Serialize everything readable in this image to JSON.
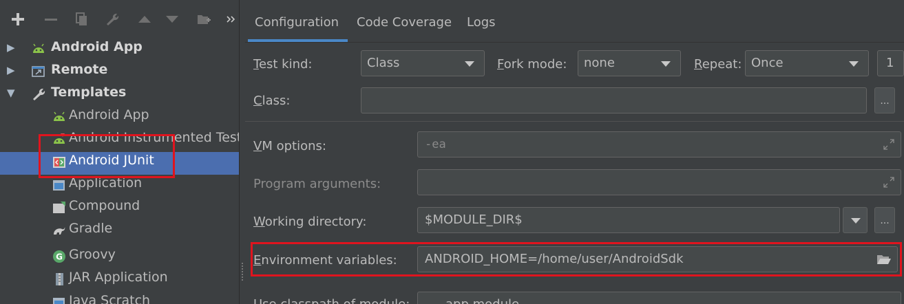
{
  "toolbar": {
    "icons": [
      "add-icon",
      "remove-icon",
      "copy-icon",
      "wrench-icon",
      "move-up-icon",
      "move-down-icon",
      "folder-add-icon",
      "more-icon"
    ]
  },
  "tree": {
    "items": [
      {
        "label": "Android App",
        "icon": "android-icon",
        "bold": true,
        "expanded": false
      },
      {
        "label": "Remote",
        "icon": "remote-icon",
        "bold": true,
        "expanded": false
      },
      {
        "label": "Templates",
        "icon": "wrench-icon",
        "bold": true,
        "expanded": true
      },
      {
        "label": "Android App",
        "icon": "android-icon"
      },
      {
        "label": "Android Instrumented Test",
        "icon": "android-test-icon"
      },
      {
        "label": "Android JUnit",
        "icon": "junit-icon",
        "selected": true
      },
      {
        "label": "Application",
        "icon": "application-icon"
      },
      {
        "label": "Compound",
        "icon": "compound-icon"
      },
      {
        "label": "Gradle",
        "icon": "gradle-icon"
      },
      {
        "label": "Groovy",
        "icon": "groovy-icon"
      },
      {
        "label": "JAR Application",
        "icon": "jar-icon"
      },
      {
        "label": "Java Scratch",
        "icon": "java-scratch-icon"
      }
    ]
  },
  "tabs": [
    {
      "label": "Configuration",
      "active": true
    },
    {
      "label": "Code Coverage"
    },
    {
      "label": "Logs"
    }
  ],
  "form": {
    "test_kind": {
      "label_u": "T",
      "label_rest": "est kind:",
      "value": "Class"
    },
    "fork_mode": {
      "label_u": "F",
      "label_rest": "ork mode:",
      "value": "none"
    },
    "repeat": {
      "label_u": "R",
      "label_rest": "epeat:",
      "value": "Once",
      "count": "1"
    },
    "class": {
      "label_u": "C",
      "label_rest": "lass:",
      "value": "",
      "button": "..."
    },
    "vm_options": {
      "label_u": "V",
      "label_rest": "M options:",
      "value": "-ea"
    },
    "program_arguments": {
      "label": "Program arguments:",
      "value": ""
    },
    "working_directory": {
      "label_u": "W",
      "label_rest": "orking directory:",
      "value": "$MODULE_DIR$",
      "button": "..."
    },
    "environment_variables": {
      "label_u": "E",
      "label_rest": "nvironment variables:",
      "value": "ANDROID_HOME=/home/user/AndroidSdk"
    },
    "use_classpath": {
      "label": "Use classpath of module:",
      "value": "app module"
    }
  },
  "colors": {
    "background": "#3c3f41",
    "selection": "#4b6eaf",
    "highlight_box": "#e0141e",
    "tab_underline": "#4a88c7"
  }
}
